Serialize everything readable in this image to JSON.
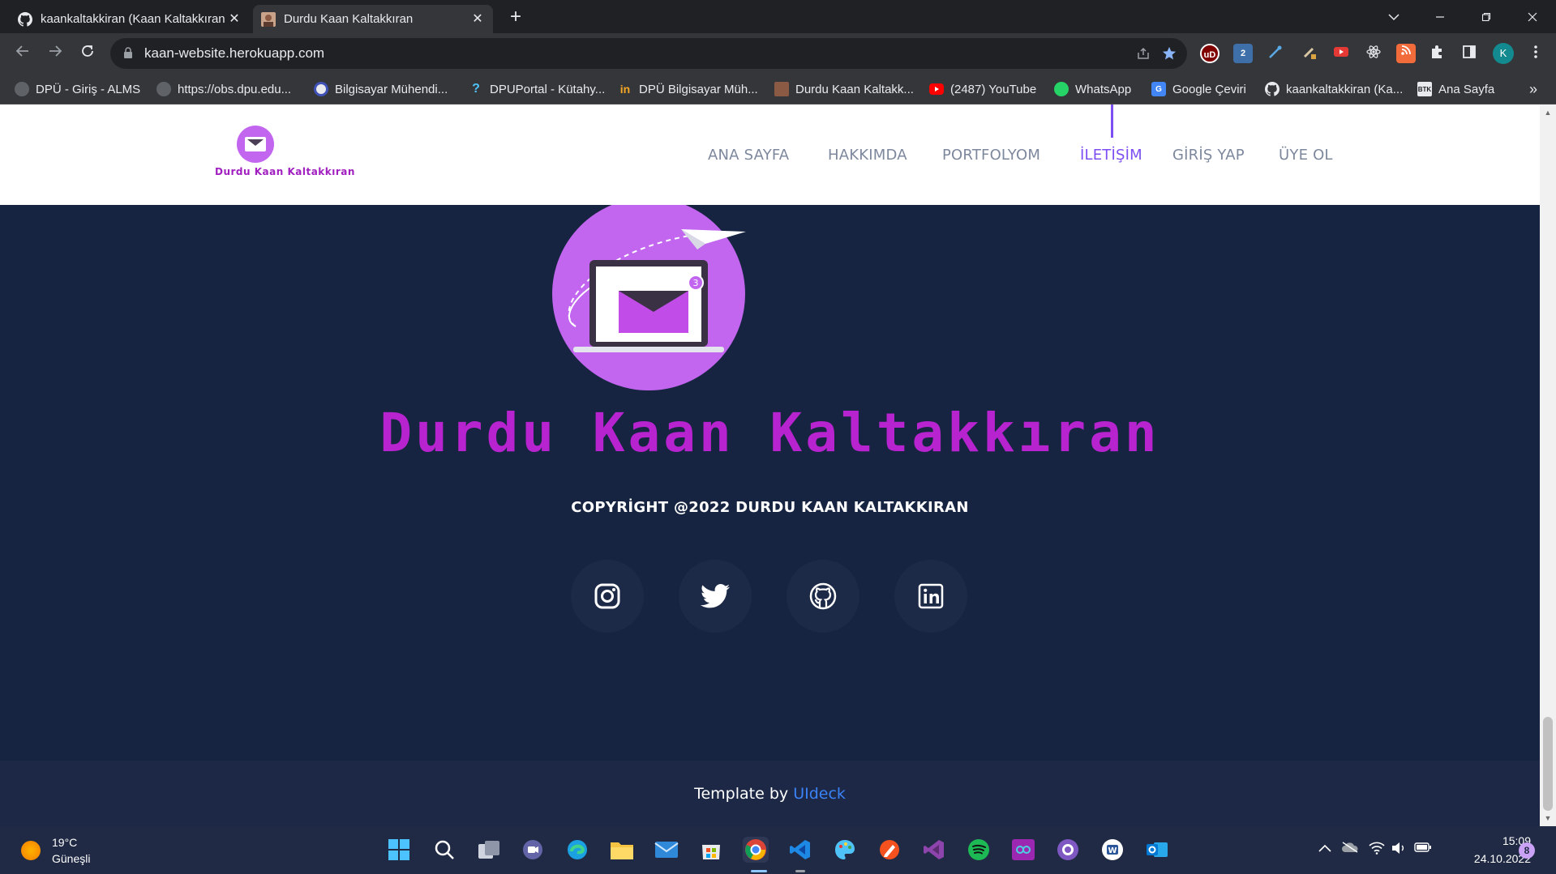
{
  "browser": {
    "tabs": [
      {
        "title": "kaankaltakkiran (Kaan Kaltakkıran",
        "close": "✕"
      },
      {
        "title": "Durdu Kaan Kaltakkıran",
        "close": "✕"
      }
    ],
    "new_tab": "+",
    "url": "kaan-website.herokuapp.com",
    "profile_initial": "K",
    "extension_labels": {
      "ublock": "uD",
      "num": "2"
    },
    "bookmarks": [
      {
        "label": "DPÜ - Giriş - ALMS",
        "icon": "globe-icon"
      },
      {
        "label": "https://obs.dpu.edu...",
        "icon": "globe-icon"
      },
      {
        "label": "Bilgisayar Mühendi...",
        "icon": "dpu-icon"
      },
      {
        "label": "DPUPortal - Kütahy...",
        "icon": "question-icon"
      },
      {
        "label": "DPÜ Bilgisayar Müh...",
        "icon": "linkedin-icon"
      },
      {
        "label": "Durdu Kaan Kaltakk...",
        "icon": "avatar-icon"
      },
      {
        "label": "(2487) YouTube",
        "icon": "youtube-icon"
      },
      {
        "label": "WhatsApp",
        "icon": "whatsapp-icon"
      },
      {
        "label": "Google Çeviri",
        "icon": "translate-icon"
      },
      {
        "label": "kaankaltakkiran (Ka...",
        "icon": "github-icon"
      },
      {
        "label": "Ana Sayfa",
        "icon": "btk-icon"
      }
    ],
    "bookmark_icon_labels": {
      "btk": "BTK"
    },
    "bookmarks_overflow": "»"
  },
  "site": {
    "logo_name": "Durdu Kaan Kaltakkıran",
    "nav": [
      {
        "label": "ANA SAYFA",
        "active": false
      },
      {
        "label": "HAKKIMDA",
        "active": false
      },
      {
        "label": "PORTFOLYOM",
        "active": false
      },
      {
        "label": "İLETİŞİM",
        "active": true
      },
      {
        "label": "GİRİŞ YAP",
        "active": false
      },
      {
        "label": "ÜYE OL",
        "active": false
      }
    ],
    "hero_badge": "3",
    "brand_title": "Durdu Kaan Kaltakkıran",
    "copyright": "COPYRİGHT @2022 DURDU KAAN KALTAKKIRAN",
    "social": [
      "instagram-icon",
      "twitter-icon",
      "github-icon",
      "linkedin-icon"
    ],
    "footer_prefix": "Template by ",
    "footer_link": "UIdeck",
    "colors": {
      "accent": "#7d4ff2",
      "brand_purple": "#b623cf",
      "background": "#172441",
      "link": "#3b82f6"
    }
  },
  "taskbar": {
    "temperature": "19°C",
    "weather": "Güneşli",
    "time": "15:09",
    "date": "24.10.2022",
    "notifications": "8"
  }
}
